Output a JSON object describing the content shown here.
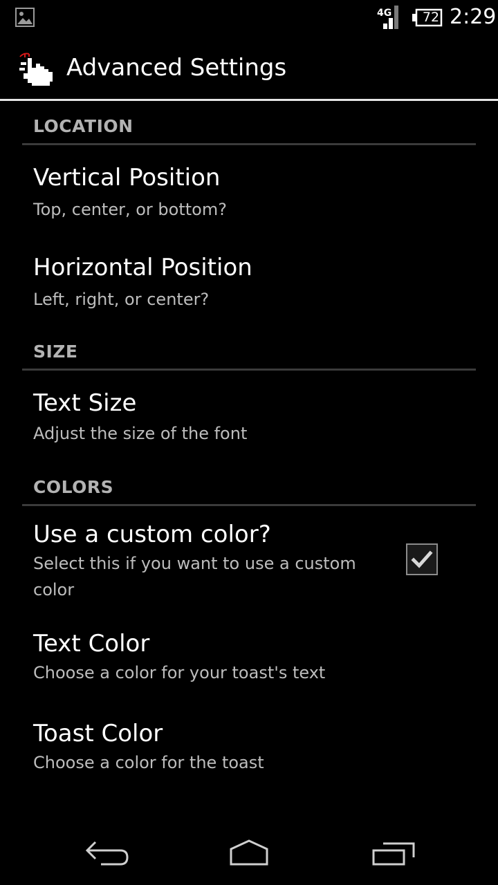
{
  "status_bar": {
    "network": "4G",
    "battery": "72",
    "time": "2:29"
  },
  "action_bar": {
    "title": "Advanced Settings"
  },
  "sections": [
    {
      "header": "LOCATION",
      "items": [
        {
          "title": "Vertical Position",
          "summary": "Top, center, or bottom?"
        },
        {
          "title": "Horizontal Position",
          "summary": "Left, right, or center?"
        }
      ]
    },
    {
      "header": "SIZE",
      "items": [
        {
          "title": "Text Size",
          "summary": "Adjust the size of the font"
        }
      ]
    },
    {
      "header": "COLORS",
      "items": [
        {
          "title": "Use a custom color?",
          "summary_line1": "Select this if you want to use a custom",
          "summary_line2": "color",
          "checked": true
        },
        {
          "title": "Text Color",
          "summary": "Choose a color for your toast's text"
        },
        {
          "title": "Toast Color",
          "summary": "Choose a color for the toast"
        }
      ]
    }
  ],
  "icons": {
    "notification": "image-icon",
    "app": "pointing-hand-icon",
    "back": "back-icon",
    "home": "home-icon",
    "recents": "recent-apps-icon"
  },
  "colors": {
    "background": "#000000",
    "text_primary": "#ffffff",
    "text_secondary": "#bdbdbd",
    "category_text": "#b3b3b3",
    "divider": "#3b3b3b"
  }
}
